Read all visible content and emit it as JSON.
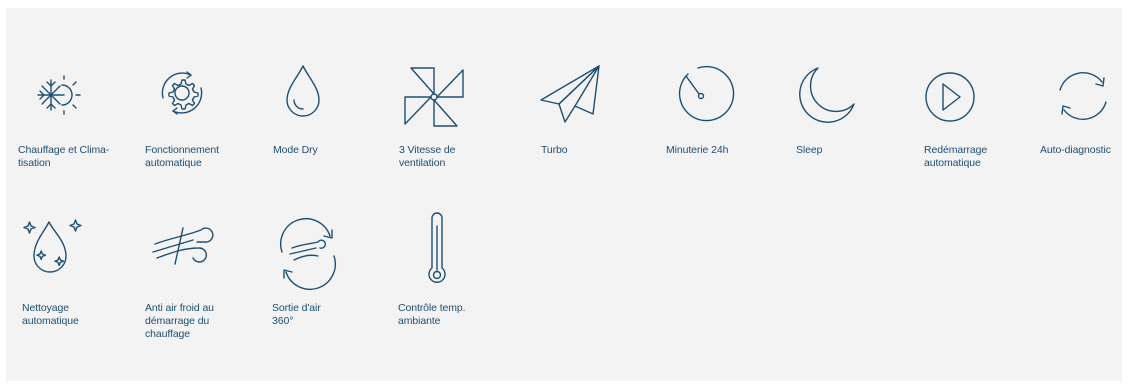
{
  "colors": {
    "background": "#f3f3f3",
    "icon_stroke": "#1f4e75",
    "text": "#1f4e75"
  },
  "features": [
    {
      "icon": "snowflake-sun-icon",
      "label": "Chauffage et Clima-\ntisation"
    },
    {
      "icon": "gear-cycle-icon",
      "label": "Fonctionnement\nautomatique"
    },
    {
      "icon": "water-drop-icon",
      "label": "Mode Dry"
    },
    {
      "icon": "pinwheel-icon",
      "label": "3 Vitesse de\nventilation"
    },
    {
      "icon": "paper-plane-icon",
      "label": "Turbo"
    },
    {
      "icon": "timer-icon",
      "label": "Minuterie 24h"
    },
    {
      "icon": "moon-icon",
      "label": "Sleep"
    },
    {
      "icon": "play-circle-icon",
      "label": "Redémarrage\nautomatique"
    },
    {
      "icon": "refresh-arrows-icon",
      "label": "Auto-diagnostic"
    },
    {
      "icon": "sparkle-drop-icon",
      "label": "Nettoyage\nautomatique"
    },
    {
      "icon": "wind-icon",
      "label": "Anti air froid au\ndémarrage du\nchauffage"
    },
    {
      "icon": "air-360-icon",
      "label": "Sortie d'air\n360°"
    },
    {
      "icon": "thermometer-icon",
      "label": "Contrôle temp.\nambiante"
    }
  ]
}
